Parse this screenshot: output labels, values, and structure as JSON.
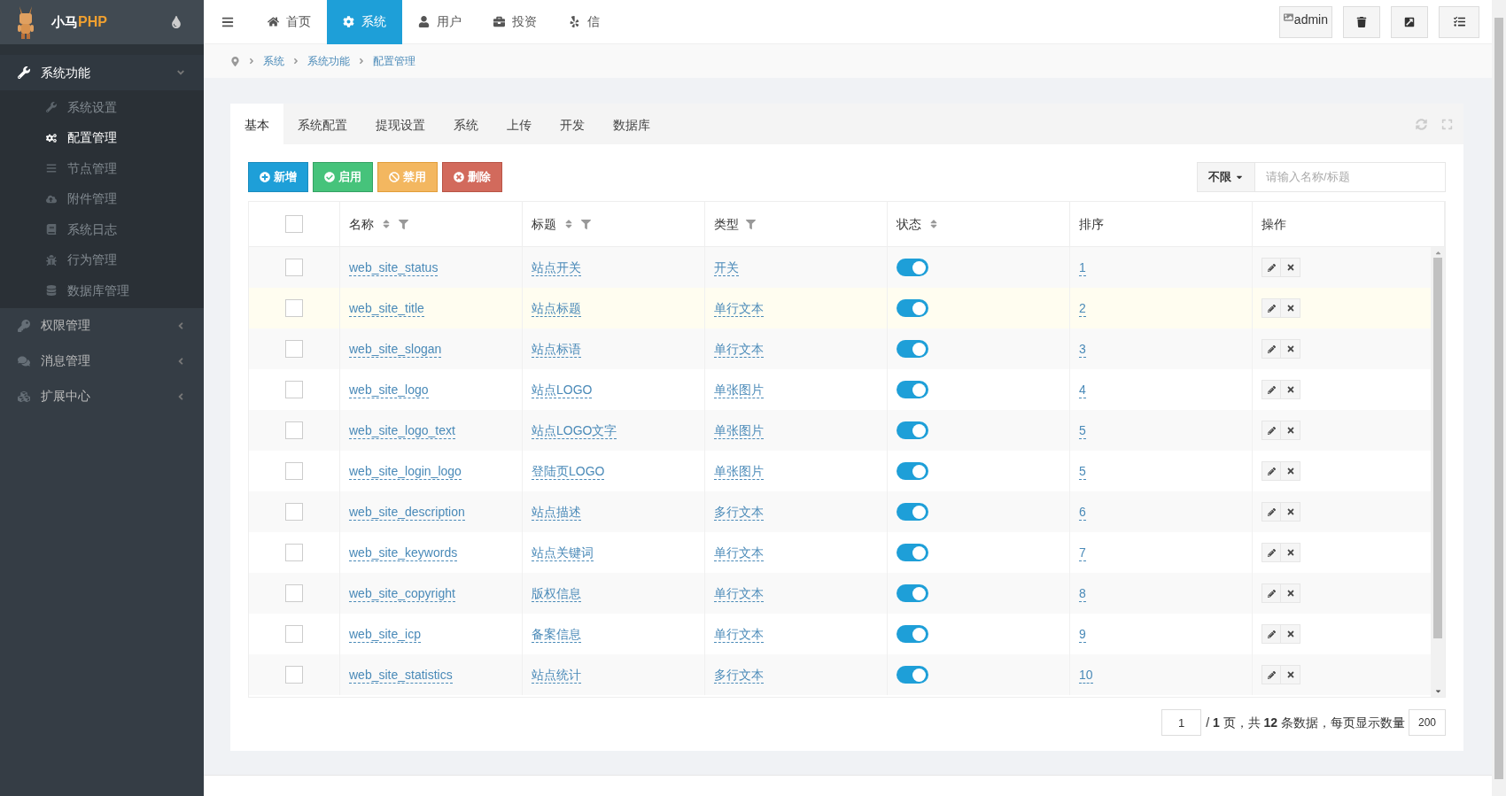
{
  "logo": {
    "text_a": "小马",
    "text_b": "PHP"
  },
  "sidebar": {
    "items": [
      {
        "label": "系统功能",
        "expanded": true,
        "children": [
          {
            "label": "系统设置",
            "selected": false
          },
          {
            "label": "配置管理",
            "selected": true
          },
          {
            "label": "节点管理",
            "selected": false
          },
          {
            "label": "附件管理",
            "selected": false
          },
          {
            "label": "系统日志",
            "selected": false
          },
          {
            "label": "行为管理",
            "selected": false
          },
          {
            "label": "数据库管理",
            "selected": false
          }
        ]
      },
      {
        "label": "权限管理",
        "expanded": false
      },
      {
        "label": "消息管理",
        "expanded": false
      },
      {
        "label": "扩展中心",
        "expanded": false
      }
    ]
  },
  "top_nav": [
    {
      "label": "首页",
      "selected": false
    },
    {
      "label": "系统",
      "selected": true
    },
    {
      "label": "用户",
      "selected": false
    },
    {
      "label": "投资",
      "selected": false
    },
    {
      "label": "信",
      "selected": false
    }
  ],
  "user_image_alt": "admin",
  "breadcrumb": [
    "系统",
    "系统功能",
    "配置管理"
  ],
  "tabs": [
    {
      "label": "基本",
      "selected": true
    },
    {
      "label": "系统配置",
      "selected": false
    },
    {
      "label": "提现设置",
      "selected": false
    },
    {
      "label": "系统",
      "selected": false
    },
    {
      "label": "上传",
      "selected": false
    },
    {
      "label": "开发",
      "selected": false
    },
    {
      "label": "数据库",
      "selected": false
    }
  ],
  "actions": [
    {
      "label": "新增",
      "kind": "add"
    },
    {
      "label": "启用",
      "kind": "enable"
    },
    {
      "label": "禁用",
      "kind": "disable"
    },
    {
      "label": "删除",
      "kind": "delete"
    }
  ],
  "search": {
    "filter": "不限",
    "placeholder": "请输入名称/标题"
  },
  "table": {
    "select_all_checked": false,
    "columns": [
      {
        "label": "名称",
        "sortable": true,
        "filterable": true
      },
      {
        "label": "标题",
        "sortable": true,
        "filterable": true
      },
      {
        "label": "类型",
        "sortable": false,
        "filterable": true
      },
      {
        "label": "状态",
        "sortable": true,
        "filterable": false
      },
      {
        "label": "排序",
        "sortable": false,
        "filterable": false
      },
      {
        "label": "操作",
        "sortable": false,
        "filterable": false
      }
    ],
    "rows": [
      {
        "checked": false,
        "highlighted": false,
        "name": "web_site_status",
        "title": "站点开关",
        "type": "开关",
        "on": true,
        "order": "1"
      },
      {
        "checked": false,
        "highlighted": true,
        "name": "web_site_title",
        "title": "站点标题",
        "type": "单行文本",
        "on": true,
        "order": "2"
      },
      {
        "checked": false,
        "highlighted": false,
        "name": "web_site_slogan",
        "title": "站点标语",
        "type": "单行文本",
        "on": true,
        "order": "3"
      },
      {
        "checked": false,
        "highlighted": false,
        "name": "web_site_logo",
        "title": "站点LOGO",
        "type": "单张图片",
        "on": true,
        "order": "4"
      },
      {
        "checked": false,
        "highlighted": false,
        "name": "web_site_logo_text",
        "title": "站点LOGO文字",
        "type": "单张图片",
        "on": true,
        "order": "5"
      },
      {
        "checked": false,
        "highlighted": false,
        "name": "web_site_login_logo",
        "title": "登陆页LOGO",
        "type": "单张图片",
        "on": true,
        "order": "5"
      },
      {
        "checked": false,
        "highlighted": false,
        "name": "web_site_description",
        "title": "站点描述",
        "type": "多行文本",
        "on": true,
        "order": "6"
      },
      {
        "checked": false,
        "highlighted": false,
        "name": "web_site_keywords",
        "title": "站点关键词",
        "type": "单行文本",
        "on": true,
        "order": "7"
      },
      {
        "checked": false,
        "highlighted": false,
        "name": "web_site_copyright",
        "title": "版权信息",
        "type": "单行文本",
        "on": true,
        "order": "8"
      },
      {
        "checked": false,
        "highlighted": false,
        "name": "web_site_icp",
        "title": "备案信息",
        "type": "单行文本",
        "on": true,
        "order": "9"
      },
      {
        "checked": false,
        "highlighted": false,
        "name": "web_site_statistics",
        "title": "站点统计",
        "type": "多行文本",
        "on": true,
        "order": "10"
      }
    ]
  },
  "pagination": {
    "page": "1",
    "pages_prefix": "/ ",
    "pages": "1",
    "mid": " 页，共 ",
    "total": "12",
    "suffix": " 条数据，每页显示数量",
    "per_page": "200"
  }
}
